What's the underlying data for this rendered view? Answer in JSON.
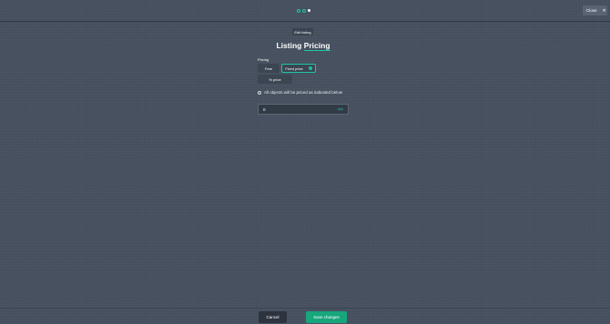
{
  "header": {
    "steps": [
      {
        "active": false
      },
      {
        "active": false
      },
      {
        "active": true
      }
    ],
    "close_label": "Close",
    "close_icon": "close-icon"
  },
  "edit_chip": "Edit listing",
  "title": {
    "prefix": "Listing ",
    "accent": "Pricing"
  },
  "pricing": {
    "label": "Pricing",
    "options": {
      "free": "Free",
      "fixed": "Fixed price",
      "percent": "% price"
    },
    "selected": "Fixed price"
  },
  "info_text": "All objects will be priced as indicated below",
  "price": {
    "value": "0",
    "unit": "tpts"
  },
  "footer": {
    "cancel": "Cancel",
    "save": "Save changes"
  },
  "colors": {
    "accent": "#1fc7a8",
    "save": "#18a67d",
    "background": "#46505f"
  }
}
